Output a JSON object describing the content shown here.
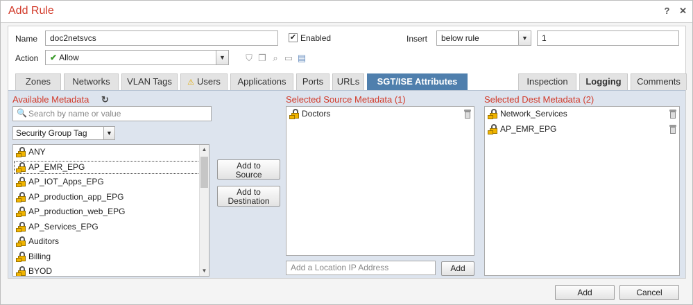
{
  "dialog": {
    "title": "Add Rule",
    "help_icon": "?",
    "close_icon": "✕"
  },
  "form": {
    "name_label": "Name",
    "name_value": "doc2netsvcs",
    "enabled_label": "Enabled",
    "enabled_checked": true,
    "insert_label": "Insert",
    "insert_value": "below rule",
    "insert_position": "1",
    "action_label": "Action",
    "action_value": "Allow",
    "action_icons": [
      "shield-icon",
      "copy-icon",
      "search-log-icon",
      "folder-icon",
      "document-icon"
    ]
  },
  "tabs": {
    "left": [
      {
        "label": "Zones",
        "active": false
      },
      {
        "label": "Networks",
        "active": false
      },
      {
        "label": "VLAN Tags",
        "active": false
      },
      {
        "label": "Users",
        "active": false,
        "warning": true
      },
      {
        "label": "Applications",
        "active": false
      },
      {
        "label": "Ports",
        "active": false
      },
      {
        "label": "URLs",
        "active": false
      },
      {
        "label": "SGT/ISE Attributes",
        "active": true
      }
    ],
    "right": [
      {
        "label": "Inspection"
      },
      {
        "label": "Logging"
      },
      {
        "label": "Comments"
      }
    ]
  },
  "available": {
    "title": "Available Metadata",
    "search_placeholder": "Search by name or value",
    "filter_value": "Security Group Tag",
    "items": [
      "ANY",
      "AP_EMR_EPG",
      "AP_IOT_Apps_EPG",
      "AP_production_app_EPG",
      "AP_production_web_EPG",
      "AP_Services_EPG",
      "Auditors",
      "Billing",
      "BYOD"
    ],
    "selected_index": 1
  },
  "buttons": {
    "add_to_source": [
      "Add to",
      "Source"
    ],
    "add_to_destination": [
      "Add to",
      "Destination"
    ],
    "add_location": "Add",
    "ok": "Add",
    "cancel": "Cancel"
  },
  "source": {
    "title": "Selected Source Metadata (1)",
    "items": [
      "Doctors"
    ],
    "location_placeholder": "Add a Location IP Address"
  },
  "dest": {
    "title": "Selected Dest Metadata (2)",
    "items": [
      "Network_Services",
      "AP_EMR_EPG"
    ]
  },
  "colors": {
    "accent": "#d23a2a",
    "active_tab": "#4f7fad",
    "content_bg": "#dde4ee"
  }
}
